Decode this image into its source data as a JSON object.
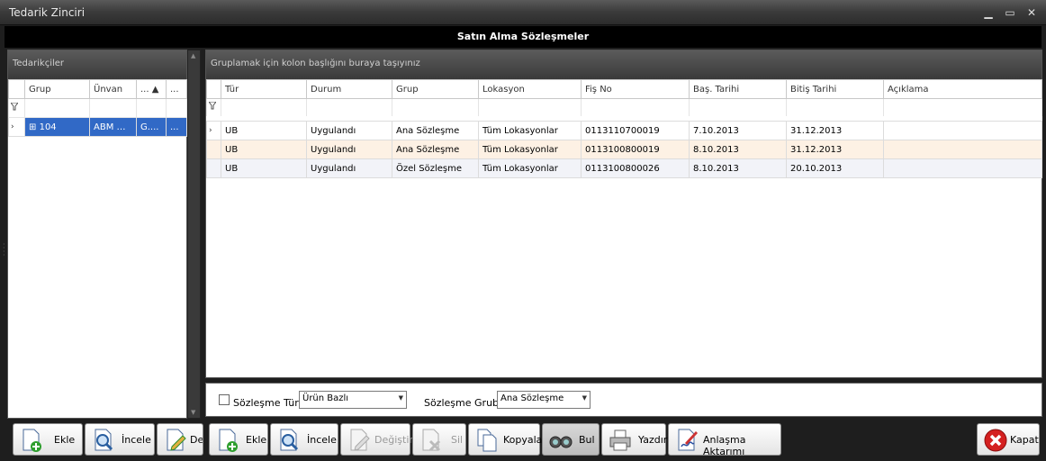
{
  "window": {
    "title": "Tedarik Zinciri",
    "minimize": "▁",
    "restore": "▭",
    "close": "✕"
  },
  "header": {
    "title": "Satın Alma Sözleşmeler"
  },
  "left": {
    "panel_title": "Tedarikçiler",
    "columns": [
      "Grup",
      "Ünvan",
      "... ▲",
      "..."
    ],
    "filter_icon": "funnel-icon",
    "rows": [
      {
        "indicator": "›",
        "expand": "⊞",
        "grup": "104",
        "unvan": "ABM GI...",
        "c3": "G....",
        "c4": "..."
      }
    ]
  },
  "right": {
    "group_hint": "Gruplamak için kolon başlığını buraya taşıyınız",
    "columns": [
      "Tür",
      "Durum",
      "Grup",
      "Lokasyon",
      "Fiş No",
      "Baş. Tarihi",
      "Bitiş Tarihi",
      "Açıklama"
    ],
    "rows": [
      {
        "indicator": "›",
        "tur": "UB",
        "durum": "Uygulandı",
        "grup": "Ana Sözleşme",
        "lokasyon": "Tüm Lokasyonlar",
        "fis": "0113110700019",
        "bas": "7.10.2013",
        "bitis": "31.12.2013",
        "aciklama": ""
      },
      {
        "indicator": "",
        "tur": "UB",
        "durum": "Uygulandı",
        "grup": "Ana Sözleşme",
        "lokasyon": "Tüm Lokasyonlar",
        "fis": "0113100800019",
        "bas": "8.10.2013",
        "bitis": "31.12.2013",
        "aciklama": ""
      },
      {
        "indicator": "",
        "tur": "UB",
        "durum": "Uygulandı",
        "grup": "Özel Sözleşme",
        "lokasyon": "Tüm Lokasyonlar",
        "fis": "0113100800026",
        "bas": "8.10.2013",
        "bitis": "20.10.2013",
        "aciklama": ""
      }
    ]
  },
  "filters": {
    "contract_type_label": "Sözleşme Türü",
    "contract_type_value": "Ürün Bazlı",
    "contract_group_label": "Sözleşme Grubu",
    "contract_group_value": "Ana Sözleşme",
    "dropdown_arrow": "▼"
  },
  "toolbar": {
    "left_ekle": "Ekle",
    "left_incele": "İncele",
    "left_degistir": "De",
    "ekle": "Ekle",
    "incele": "İncele",
    "degistir": "Değiştir",
    "sil": "Sil",
    "kopyala": "Kopyala",
    "bul": "Bul",
    "yazdir": "Yazdır",
    "anlasma": "Anlaşma Aktarımı",
    "kapat": "Kapat"
  }
}
